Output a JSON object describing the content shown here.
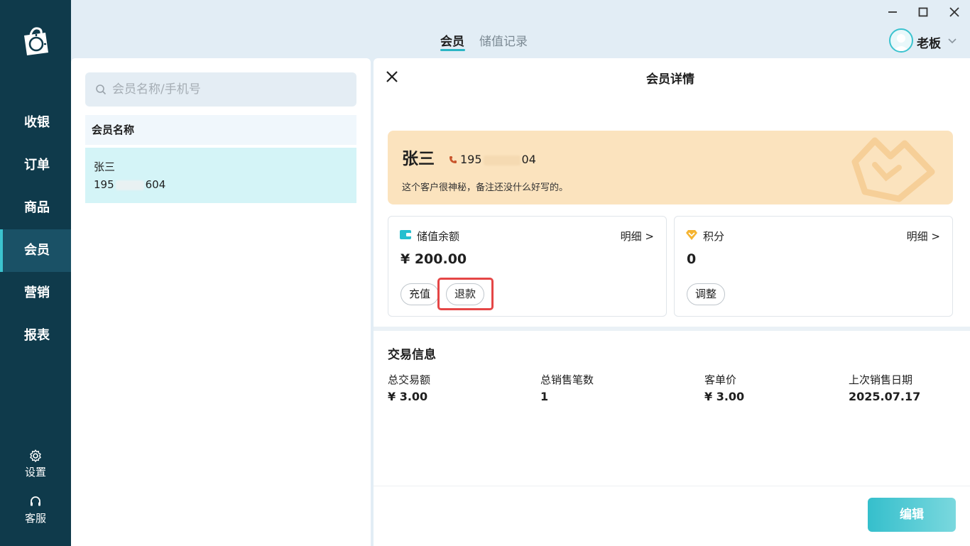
{
  "sidebar": {
    "nav": [
      "收银",
      "订单",
      "商品",
      "会员",
      "营销",
      "报表"
    ],
    "active": "会员",
    "settings_label": "设置",
    "support_label": "客服"
  },
  "topbar": {
    "tabs": [
      {
        "label": "会员",
        "active": true
      },
      {
        "label": "储值记录",
        "active": false
      }
    ],
    "user_name": "老板"
  },
  "left": {
    "search_placeholder": "会员名称/手机号",
    "list_header": "会员名称",
    "members": [
      {
        "name": "张三",
        "phone_start": "195",
        "phone_end": "604"
      }
    ]
  },
  "detail": {
    "title": "会员详情",
    "member_name": "张三",
    "phone_start": "195",
    "phone_end": "04",
    "remark": "这个客户很神秘，备注还没什么好写的。",
    "balance": {
      "label": "储值余额",
      "detail_link": "明细 >",
      "value": "¥ 200.00",
      "recharge_label": "充值",
      "refund_label": "退款"
    },
    "points": {
      "label": "积分",
      "detail_link": "明细 >",
      "value": "0",
      "adjust_label": "调整"
    },
    "transactions": {
      "title": "交易信息",
      "stats": [
        {
          "label": "总交易额",
          "value": "¥ 3.00"
        },
        {
          "label": "总销售笔数",
          "value": "1"
        },
        {
          "label": "客单价",
          "value": "¥ 3.00"
        },
        {
          "label": "上次销售日期",
          "value": "2025.07.17"
        }
      ]
    },
    "edit_label": "编辑"
  },
  "colors": {
    "sidebar_bg": "#0f3a4b",
    "accent": "#3bc3cf",
    "member_card_bg": "#fbe3be",
    "highlight_border": "#e54646"
  }
}
